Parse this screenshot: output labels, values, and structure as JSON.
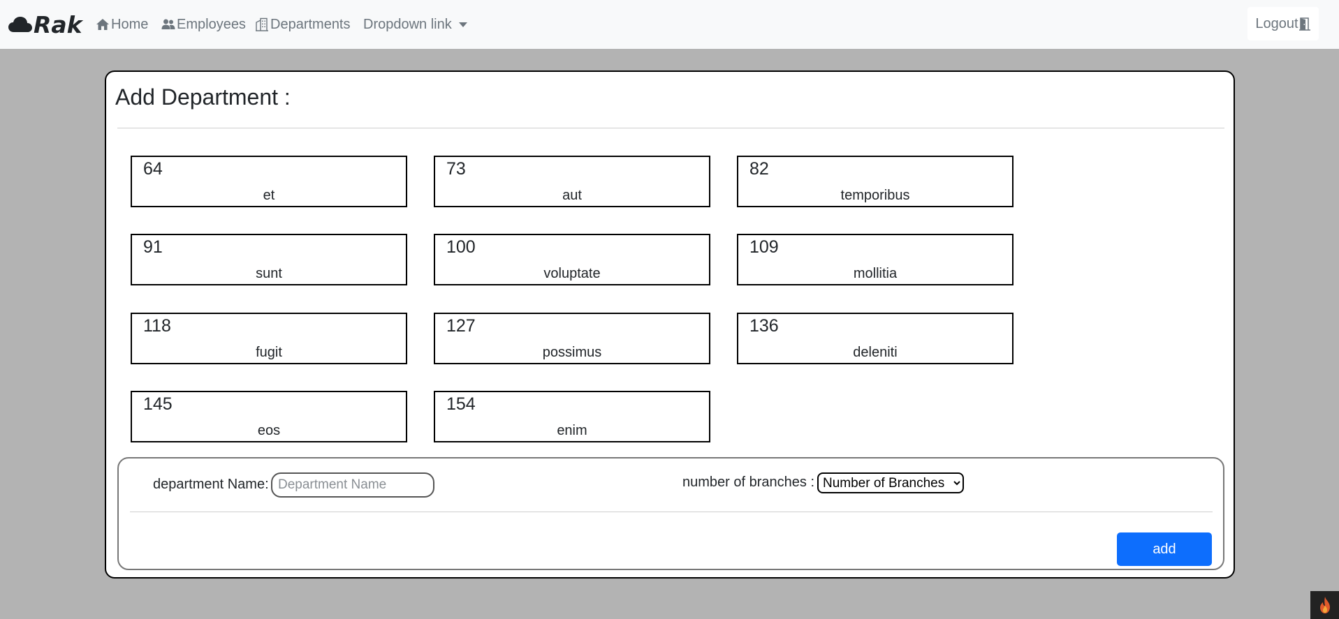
{
  "navbar": {
    "brand": "Rak",
    "items": [
      {
        "label": "Home",
        "icon": "house-icon"
      },
      {
        "label": "Employees",
        "icon": "people-icon"
      },
      {
        "label": "Departments",
        "icon": "buildings-icon"
      }
    ],
    "dropdown_label": "Dropdown link",
    "logout_label": "Logout"
  },
  "page": {
    "title": "Add Department :"
  },
  "departments": [
    {
      "id": "64",
      "name": "et"
    },
    {
      "id": "73",
      "name": "aut"
    },
    {
      "id": "82",
      "name": "temporibus"
    },
    {
      "id": "91",
      "name": "sunt"
    },
    {
      "id": "100",
      "name": "voluptate"
    },
    {
      "id": "109",
      "name": "mollitia"
    },
    {
      "id": "118",
      "name": "fugit"
    },
    {
      "id": "127",
      "name": "possimus"
    },
    {
      "id": "136",
      "name": "deleniti"
    },
    {
      "id": "145",
      "name": "eos"
    },
    {
      "id": "154",
      "name": "enim"
    }
  ],
  "form": {
    "name_label": "department Name:",
    "name_placeholder": "Department Name",
    "name_value": "",
    "branches_label": "number of branches :",
    "branches_selected": "Number of Branches",
    "add_label": "add"
  },
  "colors": {
    "primary": "#0d6efd",
    "background": "#b3b3b3",
    "navbar": "#f8f9fa",
    "nav_text": "#6c757d"
  }
}
